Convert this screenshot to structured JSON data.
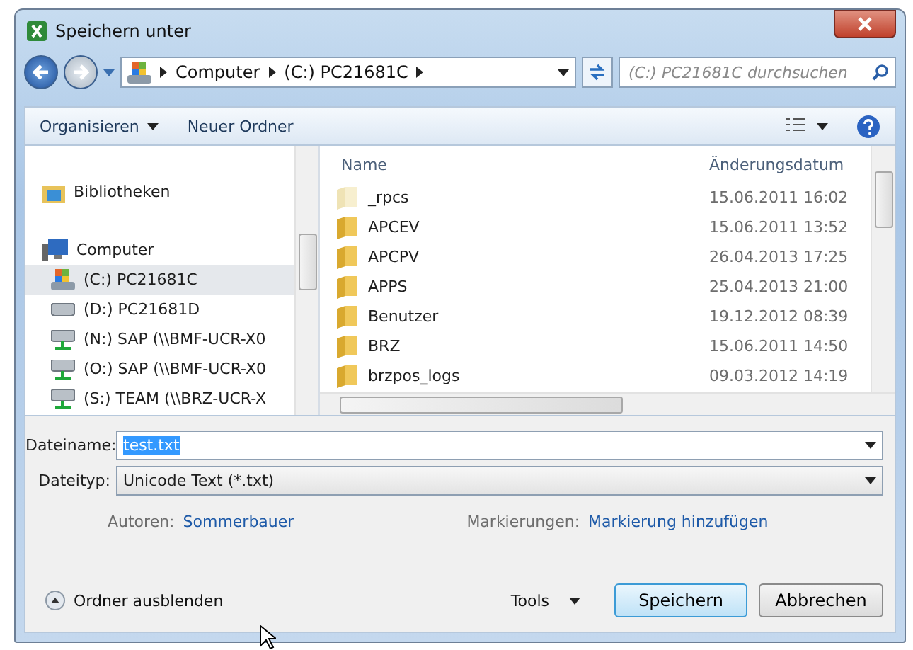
{
  "window": {
    "title": "Speichern unter"
  },
  "address": {
    "crumbs": [
      "Computer",
      "(C:) PC21681C"
    ]
  },
  "search": {
    "placeholder": "(C:) PC21681C durchsuchen"
  },
  "toolbar": {
    "buttons": [
      "Organisieren",
      "Neuer Ordner"
    ]
  },
  "sidebar": {
    "items": [
      {
        "kind": "library",
        "label": "Bibliotheken",
        "selected": false
      },
      {
        "kind": "computer",
        "label": "Computer",
        "selected": false
      },
      {
        "kind": "system",
        "label": "(C:) PC21681C",
        "selected": true
      },
      {
        "kind": "drive",
        "label": "(D:) PC21681D",
        "selected": false
      },
      {
        "kind": "network",
        "label": "(N:) SAP (\\\\BMF-UCR-X0",
        "selected": false
      },
      {
        "kind": "network",
        "label": "(O:) SAP (\\\\BMF-UCR-X0",
        "selected": false
      },
      {
        "kind": "network",
        "label": "(S:) TEAM (\\\\BRZ-UCR-X",
        "selected": false
      }
    ]
  },
  "table": {
    "columns": [
      "Name",
      "Änderungsdatum"
    ],
    "rows": [
      {
        "name": "_rpcs",
        "date": "15.06.2011 16:02",
        "kind": "light"
      },
      {
        "name": "APCEV",
        "date": "15.06.2011 13:52",
        "kind": "folder"
      },
      {
        "name": "APCPV",
        "date": "26.04.2013 17:25",
        "kind": "folder"
      },
      {
        "name": "APPS",
        "date": "25.04.2013 21:00",
        "kind": "folder"
      },
      {
        "name": "Benutzer",
        "date": "19.12.2012 08:39",
        "kind": "folder"
      },
      {
        "name": "BRZ",
        "date": "15.06.2011 14:50",
        "kind": "folder"
      },
      {
        "name": "brzpos_logs",
        "date": "09.03.2012 14:19",
        "kind": "folder"
      }
    ]
  },
  "form": {
    "filename_label": "Dateiname:",
    "filename": "test.txt",
    "filetype_label": "Dateityp:",
    "filetype": "Unicode Text (*.txt)",
    "authors_label": "Autoren:",
    "authors": "Sommerbauer",
    "tags_label": "Markierungen:",
    "tags": "Markierung hinzufügen"
  },
  "footer": {
    "toggle": "Ordner ausblenden",
    "tools": "Tools",
    "save": "Speichern",
    "cancel": "Abbrechen"
  }
}
